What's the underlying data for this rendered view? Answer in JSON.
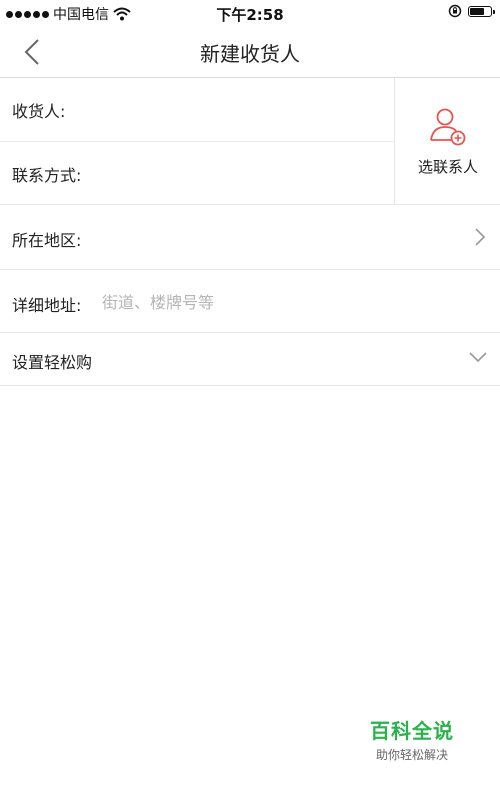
{
  "status_bar": {
    "carrier": "中国电信",
    "time": "下午2:58",
    "battery_level": 0.75
  },
  "nav": {
    "title": "新建收货人"
  },
  "form": {
    "receiver_label": "收货人:",
    "contact_label": "联系方式:",
    "pick_contact_label": "选联系人",
    "region_label": "所在地区:",
    "address_label": "详细地址:",
    "address_placeholder": "街道、楼牌号等",
    "easy_buy_label": "设置轻松购"
  },
  "colors": {
    "accent_red": "#e8534f",
    "watermark_green": "#2bb24c"
  },
  "watermark": {
    "title": "百科全说",
    "subtitle": "助你轻松解决"
  }
}
